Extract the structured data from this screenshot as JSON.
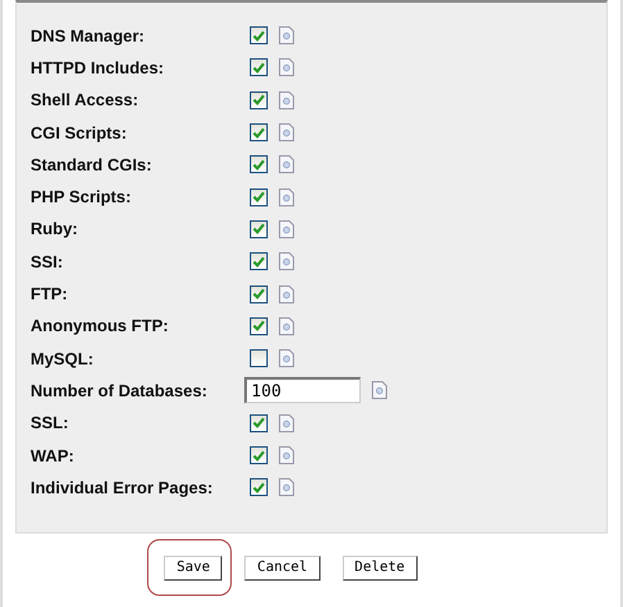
{
  "settings": [
    {
      "label": "DNS Manager:",
      "kind": "checkbox",
      "checked": true
    },
    {
      "label": "HTTPD Includes:",
      "kind": "checkbox",
      "checked": true
    },
    {
      "label": "Shell Access:",
      "kind": "checkbox",
      "checked": true
    },
    {
      "label": "CGI Scripts:",
      "kind": "checkbox",
      "checked": true
    },
    {
      "label": "Standard CGIs:",
      "kind": "checkbox",
      "checked": true
    },
    {
      "label": "PHP Scripts:",
      "kind": "checkbox",
      "checked": true
    },
    {
      "label": "Ruby:",
      "kind": "checkbox",
      "checked": true
    },
    {
      "label": "SSI:",
      "kind": "checkbox",
      "checked": true
    },
    {
      "label": "FTP:",
      "kind": "checkbox",
      "checked": true
    },
    {
      "label": "Anonymous FTP:",
      "kind": "checkbox",
      "checked": true
    },
    {
      "label": "MySQL:",
      "kind": "checkbox",
      "checked": false
    },
    {
      "label": "Number of Databases:",
      "kind": "number",
      "value": "100"
    },
    {
      "label": "SSL:",
      "kind": "checkbox",
      "checked": true
    },
    {
      "label": "WAP:",
      "kind": "checkbox",
      "checked": true
    },
    {
      "label": "Individual Error Pages:",
      "kind": "checkbox",
      "checked": true
    }
  ],
  "buttons": [
    {
      "label": "Save",
      "highlighted": true
    },
    {
      "label": "Cancel",
      "highlighted": false
    },
    {
      "label": "Delete",
      "highlighted": false
    }
  ]
}
